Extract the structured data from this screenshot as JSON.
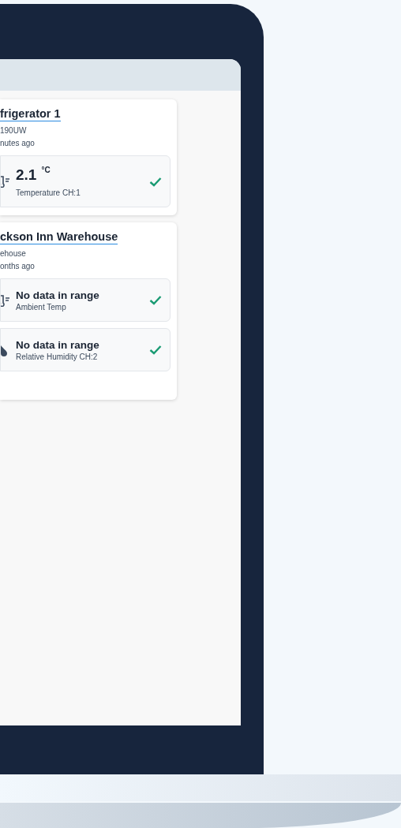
{
  "devices": [
    {
      "name": "frigerator 1",
      "subtitle": "190UW",
      "updated": "nutes ago",
      "sensors": [
        {
          "kind": "temperature",
          "value": "2.1",
          "unit": "°C",
          "label": "Temperature CH:1",
          "ok": true
        }
      ]
    },
    {
      "name": "ckson Inn Warehouse",
      "subtitle": "ehouse",
      "updated": "onths ago",
      "sensors": [
        {
          "kind": "temperature",
          "value": "No data in range",
          "label": "Ambient Temp",
          "ok": true
        },
        {
          "kind": "humidity",
          "value": "No data in range",
          "label": "Relative Humidity CH:2",
          "ok": true
        }
      ]
    }
  ]
}
